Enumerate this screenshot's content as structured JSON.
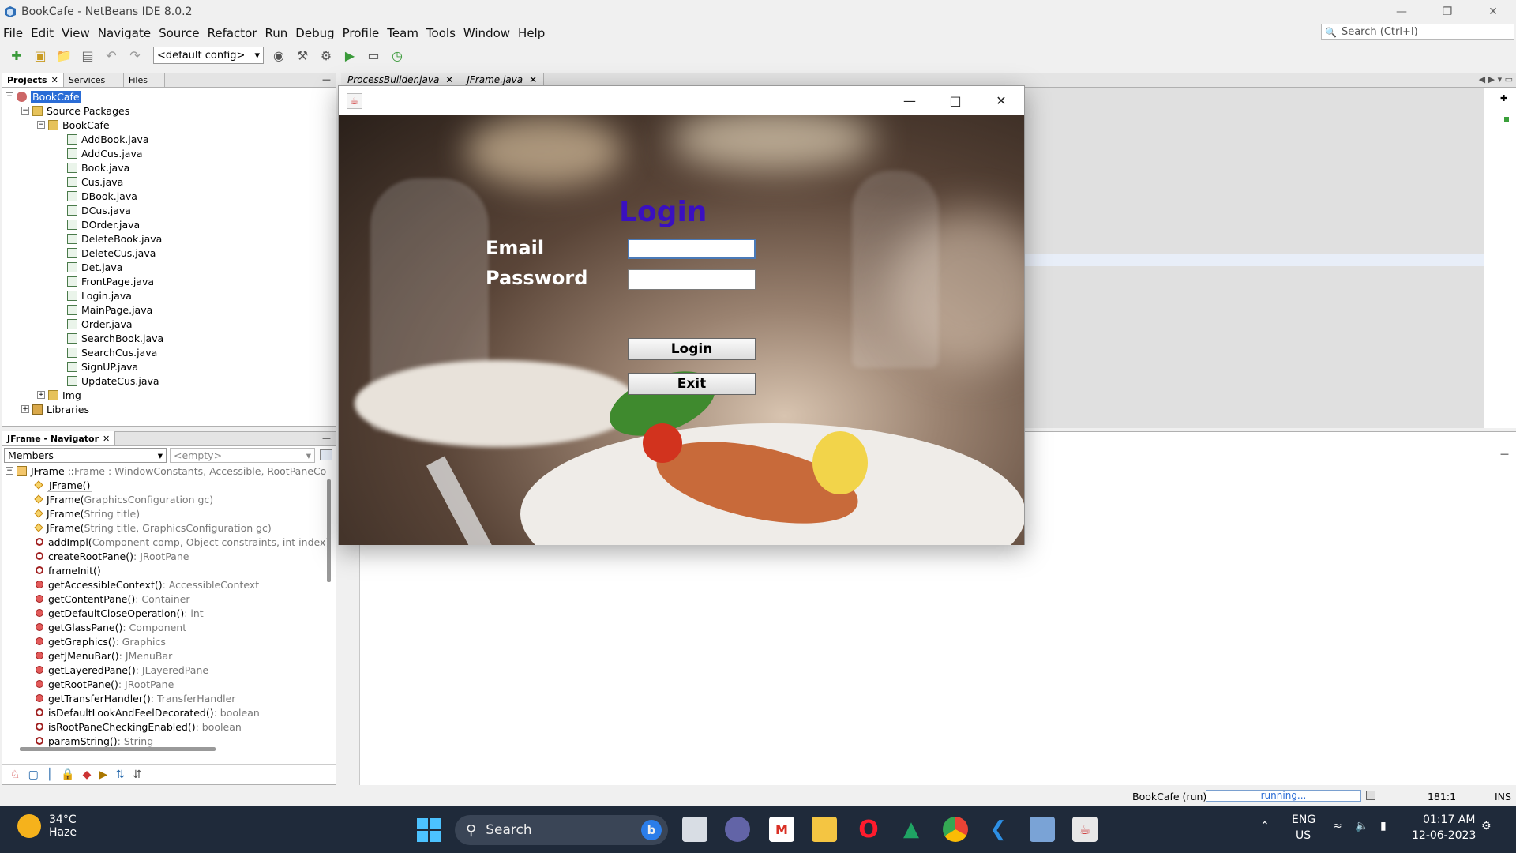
{
  "window": {
    "title": "BookCafe - NetBeans IDE 8.0.2",
    "controls": [
      "—",
      "❐",
      "✕"
    ]
  },
  "menus": [
    "File",
    "Edit",
    "View",
    "Navigate",
    "Source",
    "Refactor",
    "Run",
    "Debug",
    "Profile",
    "Team",
    "Tools",
    "Window",
    "Help"
  ],
  "search": {
    "placeholder": "Search (Ctrl+I)"
  },
  "toolbar": {
    "config": "<default config>"
  },
  "projects_pane": {
    "tabs": [
      "Projects",
      "Services",
      "Files"
    ],
    "project": "BookCafe",
    "source_packages": "Source Packages",
    "package": "BookCafe",
    "files": [
      "AddBook.java",
      "AddCus.java",
      "Book.java",
      "Cus.java",
      "DBook.java",
      "DCus.java",
      "DOrder.java",
      "DeleteBook.java",
      "DeleteCus.java",
      "Det.java",
      "FrontPage.java",
      "Login.java",
      "MainPage.java",
      "Order.java",
      "SearchBook.java",
      "SearchCus.java",
      "SignUP.java",
      "UpdateCus.java"
    ],
    "img": "Img",
    "libraries": "Libraries"
  },
  "navigator": {
    "tab": "JFrame - Navigator",
    "filter": "Members",
    "filter2": "<empty>",
    "root": {
      "name": "JFrame :: ",
      "rest": "Frame : WindowConstants, Accessible, RootPaneCo"
    },
    "members": [
      {
        "name": "JFrame()",
        "type": "",
        "kind": "ctor"
      },
      {
        "name": "JFrame(",
        "type": "GraphicsConfiguration gc)",
        "kind": "ctor"
      },
      {
        "name": "JFrame(",
        "type": "String title)",
        "kind": "ctor"
      },
      {
        "name": "JFrame(",
        "type": "String title, GraphicsConfiguration gc)",
        "kind": "ctor"
      },
      {
        "name": "addImpl(",
        "type": "Component comp, Object constraints, int index)",
        "kind": "gear"
      },
      {
        "name": "createRootPane()",
        "type": " : JRootPane",
        "kind": "gear"
      },
      {
        "name": "frameInit()",
        "type": "",
        "kind": "gear"
      },
      {
        "name": "getAccessibleContext()",
        "type": " : AccessibleContext",
        "kind": "method"
      },
      {
        "name": "getContentPane()",
        "type": " : Container",
        "kind": "method"
      },
      {
        "name": "getDefaultCloseOperation()",
        "type": " : int",
        "kind": "method"
      },
      {
        "name": "getGlassPane()",
        "type": " : Component",
        "kind": "method"
      },
      {
        "name": "getGraphics()",
        "type": " : Graphics",
        "kind": "method"
      },
      {
        "name": "getJMenuBar()",
        "type": " : JMenuBar",
        "kind": "method"
      },
      {
        "name": "getLayeredPane()",
        "type": " : JLayeredPane",
        "kind": "method"
      },
      {
        "name": "getRootPane()",
        "type": " : JRootPane",
        "kind": "method"
      },
      {
        "name": "getTransferHandler()",
        "type": " : TransferHandler",
        "kind": "method"
      },
      {
        "name": "isDefaultLookAndFeelDecorated()",
        "type": " : boolean",
        "kind": "gear"
      },
      {
        "name": "isRootPaneCheckingEnabled()",
        "type": " : boolean",
        "kind": "gear"
      },
      {
        "name": "paramString()",
        "type": " : String",
        "kind": "gear"
      }
    ]
  },
  "editor": {
    "tabs": [
      "ProcessBuilder.java",
      "JFrame.java"
    ]
  },
  "login": {
    "heading": "Login",
    "email_label": "Email",
    "password_label": "Password",
    "email_value": "",
    "password_value": "",
    "login_button": "Login",
    "exit_button": "Exit",
    "colors": {
      "heading": "#3a10c0",
      "label": "#ffffff"
    }
  },
  "status": {
    "run": "BookCafe (run)",
    "progress": "running...",
    "position": "181:1",
    "mode": "INS"
  },
  "taskbar": {
    "weather_temp": "34°C",
    "weather_desc": "Haze",
    "search": "Search",
    "lang1": "ENG",
    "lang2": "US",
    "time": "01:17 AM",
    "date": "12-06-2023"
  }
}
